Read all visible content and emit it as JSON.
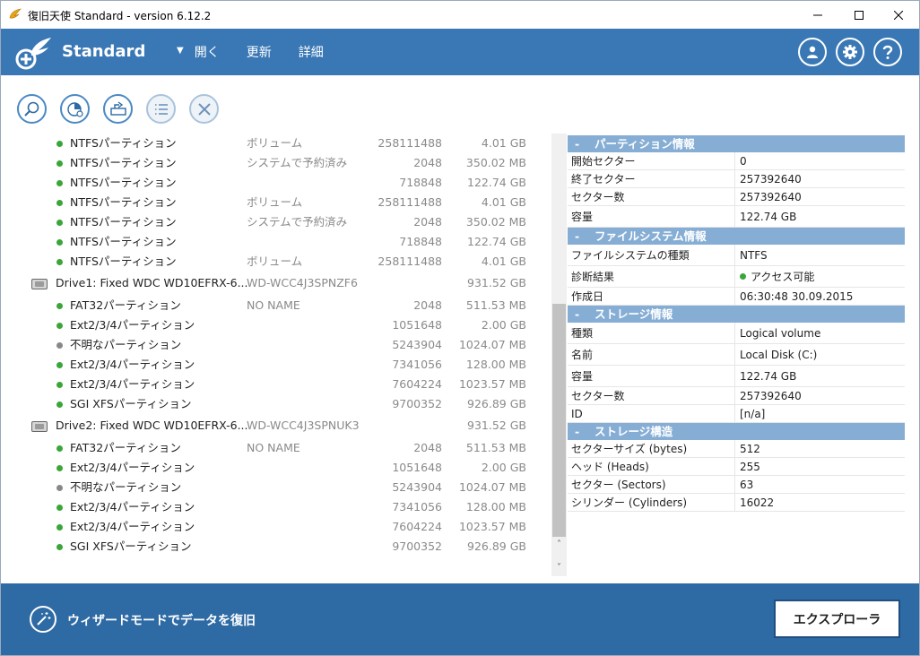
{
  "window": {
    "title": "復旧天使 Standard - version 6.12.2",
    "minimize": "—",
    "maximize": "□",
    "close": "✕"
  },
  "header": {
    "product": "Standard",
    "menu_arrow": "▼",
    "menu": [
      "開く",
      "更新",
      "詳細"
    ],
    "accent": "#3a78b5",
    "buttons": [
      "user-icon",
      "gear-icon",
      "help-icon"
    ]
  },
  "toolbar": {
    "buttons": [
      "search-icon",
      "scan-chart-icon",
      "export-icon",
      "list-icon",
      "close-icon"
    ]
  },
  "tree": {
    "rows": [
      {
        "type": "partition",
        "status": "ok",
        "name": "NTFSパーティション",
        "label": "ボリューム",
        "sectors": "258111488",
        "size": "4.01 GB"
      },
      {
        "type": "partition",
        "status": "ok",
        "name": "NTFSパーティション",
        "label": "システムで予約済み",
        "sectors": "2048",
        "size": "350.02 MB"
      },
      {
        "type": "partition",
        "status": "ok",
        "name": "NTFSパーティション",
        "label": "",
        "sectors": "718848",
        "size": "122.74 GB"
      },
      {
        "type": "partition",
        "status": "ok",
        "name": "NTFSパーティション",
        "label": "ボリューム",
        "sectors": "258111488",
        "size": "4.01 GB"
      },
      {
        "type": "partition",
        "status": "ok",
        "name": "NTFSパーティション",
        "label": "システムで予約済み",
        "sectors": "2048",
        "size": "350.02 MB"
      },
      {
        "type": "partition",
        "status": "ok",
        "name": "NTFSパーティション",
        "label": "",
        "sectors": "718848",
        "size": "122.74 GB"
      },
      {
        "type": "partition",
        "status": "ok",
        "name": "NTFSパーティション",
        "label": "ボリューム",
        "sectors": "258111488",
        "size": "4.01 GB"
      },
      {
        "type": "drive",
        "status": "",
        "name": "Drive1: Fixed WDC WD10EFRX-6...",
        "label": "WD-WCC4J3SPNZF6",
        "sectors": "",
        "size": "931.52 GB"
      },
      {
        "type": "partition",
        "status": "ok",
        "name": "FAT32パーティション",
        "label": "NO NAME",
        "sectors": "2048",
        "size": "511.53 MB"
      },
      {
        "type": "partition",
        "status": "ok",
        "name": "Ext2/3/4パーティション",
        "label": "",
        "sectors": "1051648",
        "size": "2.00 GB"
      },
      {
        "type": "partition",
        "status": "unknown",
        "name": "不明なパーティション",
        "label": "",
        "sectors": "5243904",
        "size": "1024.07 MB"
      },
      {
        "type": "partition",
        "status": "ok",
        "name": "Ext2/3/4パーティション",
        "label": "",
        "sectors": "7341056",
        "size": "128.00 MB"
      },
      {
        "type": "partition",
        "status": "ok",
        "name": "Ext2/3/4パーティション",
        "label": "",
        "sectors": "7604224",
        "size": "1023.57 MB"
      },
      {
        "type": "partition",
        "status": "ok",
        "name": "SGI XFSパーティション",
        "label": "",
        "sectors": "9700352",
        "size": "926.89 GB"
      },
      {
        "type": "drive",
        "status": "",
        "name": "Drive2: Fixed WDC WD10EFRX-6...",
        "label": "WD-WCC4J3SPNUK3",
        "sectors": "",
        "size": "931.52 GB"
      },
      {
        "type": "partition",
        "status": "ok",
        "name": "FAT32パーティション",
        "label": "NO NAME",
        "sectors": "2048",
        "size": "511.53 MB"
      },
      {
        "type": "partition",
        "status": "ok",
        "name": "Ext2/3/4パーティション",
        "label": "",
        "sectors": "1051648",
        "size": "2.00 GB"
      },
      {
        "type": "partition",
        "status": "unknown",
        "name": "不明なパーティション",
        "label": "",
        "sectors": "5243904",
        "size": "1024.07 MB"
      },
      {
        "type": "partition",
        "status": "ok",
        "name": "Ext2/3/4パーティション",
        "label": "",
        "sectors": "7341056",
        "size": "128.00 MB"
      },
      {
        "type": "partition",
        "status": "ok",
        "name": "Ext2/3/4パーティション",
        "label": "",
        "sectors": "7604224",
        "size": "1023.57 MB"
      },
      {
        "type": "partition",
        "status": "ok",
        "name": "SGI XFSパーティション",
        "label": "",
        "sectors": "9700352",
        "size": "926.89 GB"
      }
    ],
    "scroll_up": "˄",
    "scroll_down": "˅"
  },
  "properties": {
    "sections": [
      {
        "minus": "-",
        "title": "パーティション情報",
        "rows": [
          {
            "k": "開始セクター",
            "v": "0"
          },
          {
            "k": "終了セクター",
            "v": "257392640"
          },
          {
            "k": "セクター数",
            "v": "257392640"
          },
          {
            "k": "容量",
            "v": "122.74 GB",
            "tall": true
          }
        ]
      },
      {
        "minus": "-",
        "title": "ファイルシステム情報",
        "rows": [
          {
            "k": "ファイルシステムの種類",
            "v": "NTFS",
            "tall": true
          },
          {
            "k": "診断結果",
            "v": "アクセス可能",
            "status": "ok",
            "tall": true
          },
          {
            "k": "作成日",
            "v": "06:30:48 30.09.2015"
          }
        ]
      },
      {
        "minus": "-",
        "title": "ストレージ情報",
        "rows": [
          {
            "k": "種類",
            "v": "Logical volume",
            "tall": true
          },
          {
            "k": "名前",
            "v": "Local Disk (C:)",
            "tall": true
          },
          {
            "k": "容量",
            "v": "122.74 GB",
            "tall": true
          },
          {
            "k": "セクター数",
            "v": "257392640"
          },
          {
            "k": "ID",
            "v": "[n/a]"
          }
        ]
      },
      {
        "minus": "-",
        "title": "ストレージ構造",
        "rows": [
          {
            "k": "セクターサイズ (bytes)",
            "v": "512"
          },
          {
            "k": "ヘッド (Heads)",
            "v": "255"
          },
          {
            "k": "セクター (Sectors)",
            "v": "63"
          },
          {
            "k": "シリンダー (Cylinders)",
            "v": "16022"
          }
        ]
      }
    ]
  },
  "footer": {
    "wizard_label": "ウィザードモードでデータを復旧",
    "explorer_label": "エクスプローラ",
    "color": "#2e6aa4"
  }
}
